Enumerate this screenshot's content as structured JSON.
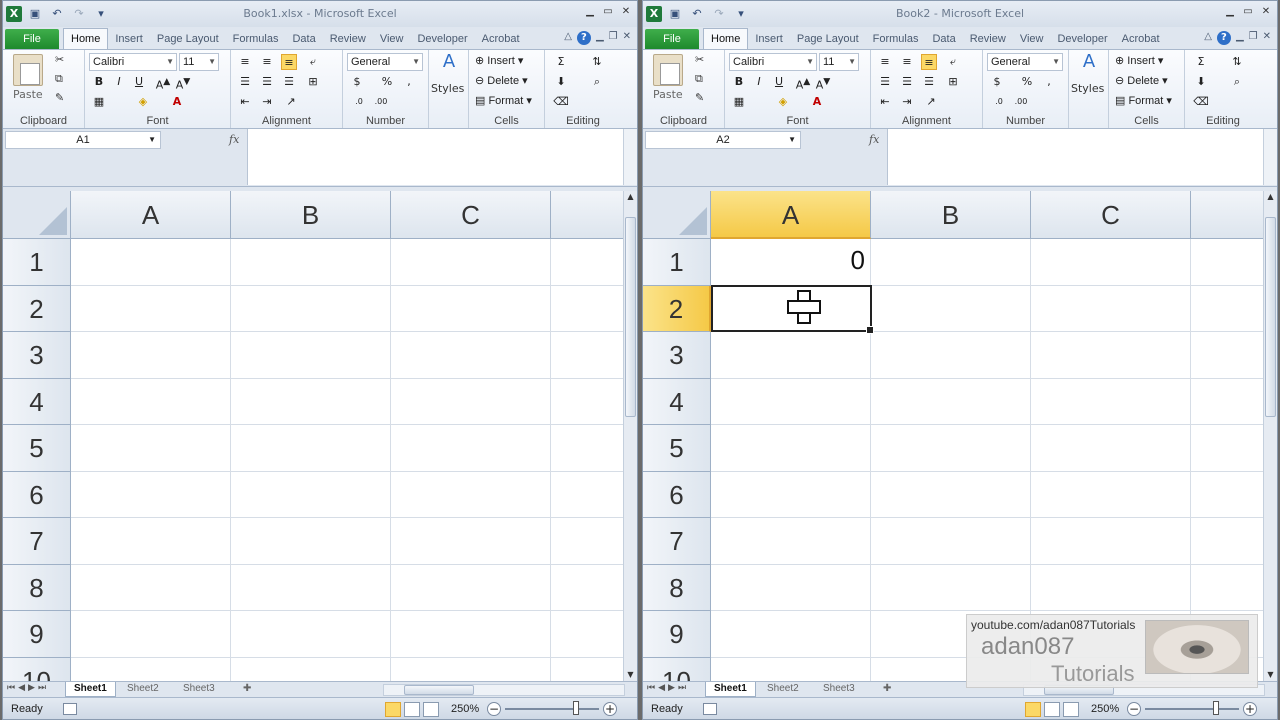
{
  "windows": [
    {
      "title": "Book1.xlsx - Microsoft Excel",
      "tabs": [
        "File",
        "Home",
        "Insert",
        "Page Layout",
        "Formulas",
        "Data",
        "Review",
        "View",
        "Developer",
        "Acrobat"
      ],
      "active_tab": "Home",
      "ribbon": {
        "paste_label": "Paste",
        "font_name": "Calibri",
        "font_size": "11",
        "number_format": "General",
        "bold": "B",
        "italic": "I",
        "underline": "U",
        "styles_label": "Styles",
        "insert_label": "Insert",
        "delete_label": "Delete",
        "format_label": "Format",
        "groups": {
          "clipboard": "Clipboard",
          "font": "Font",
          "alignment": "Alignment",
          "number": "Number",
          "cells": "Cells",
          "editing": "Editing"
        }
      },
      "name_box": "A1",
      "fx": "fx",
      "columns": [
        "A",
        "B",
        "C"
      ],
      "rows": [
        "1",
        "2",
        "3",
        "4",
        "5",
        "6",
        "7",
        "8",
        "9",
        "10"
      ],
      "sheets": [
        "Sheet1",
        "Sheet2",
        "Sheet3"
      ],
      "status": "Ready",
      "zoom": "250%"
    },
    {
      "title": "Book2 - Microsoft Excel",
      "tabs": [
        "File",
        "Home",
        "Insert",
        "Page Layout",
        "Formulas",
        "Data",
        "Review",
        "View",
        "Developer",
        "Acrobat"
      ],
      "active_tab": "Home",
      "ribbon": {
        "paste_label": "Paste",
        "font_name": "Calibri",
        "font_size": "11",
        "number_format": "General",
        "bold": "B",
        "italic": "I",
        "underline": "U",
        "styles_label": "Styles",
        "insert_label": "Insert",
        "delete_label": "Delete",
        "format_label": "Format",
        "groups": {
          "clipboard": "Clipboard",
          "font": "Font",
          "alignment": "Alignment",
          "number": "Number",
          "cells": "Cells",
          "editing": "Editing"
        }
      },
      "name_box": "A2",
      "fx": "fx",
      "columns": [
        "A",
        "B",
        "C"
      ],
      "rows": [
        "1",
        "2",
        "3",
        "4",
        "5",
        "6",
        "7",
        "8",
        "9",
        "10"
      ],
      "cell_A1": "0",
      "sheets": [
        "Sheet1",
        "Sheet2",
        "Sheet3"
      ],
      "status": "Ready",
      "zoom": "250%"
    }
  ],
  "watermark": {
    "url": "youtube.com/adan087Tutorials",
    "brand": "adan087",
    "sub": "Tutorials"
  },
  "colors": {
    "selection_header": "#f5c947",
    "excel_green": "#1f7a3a"
  }
}
